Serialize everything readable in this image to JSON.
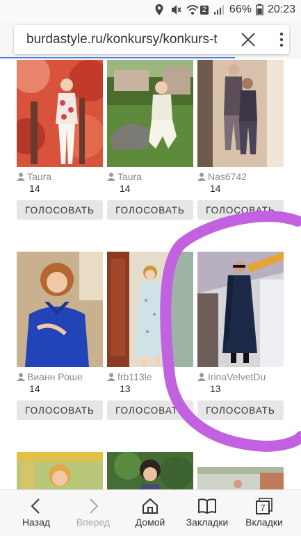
{
  "status": {
    "battery": "66%",
    "time": "20:23",
    "badge": "2"
  },
  "browser": {
    "url": "burdastyle.ru/konkursy/konkurs-t"
  },
  "entries": [
    {
      "author": "Taura",
      "votes": "14",
      "vote_label": "ГОЛОСОВАТЬ"
    },
    {
      "author": "Taura",
      "votes": "14",
      "vote_label": "ГОЛОСОВАТЬ"
    },
    {
      "author": "Nas6742",
      "votes": "14",
      "vote_label": "ГОЛОСОВАТЬ"
    },
    {
      "author": "Вианн Роше",
      "votes": "14",
      "vote_label": "ГОЛОСОВАТЬ"
    },
    {
      "author": "frb113le",
      "votes": "13",
      "vote_label": "ГОЛОСОВАТЬ"
    },
    {
      "author": "IrinaVelvetDu",
      "votes": "13",
      "vote_label": "ГОЛОСОВАТЬ"
    }
  ],
  "nav": {
    "back": "Назад",
    "forward": "Вперед",
    "home": "Домой",
    "bookmarks": "Закладки",
    "tabs": "Вкладки",
    "tabs_count": "7"
  },
  "colors": {
    "marker": "#c262e0",
    "progress": "#4c7be6"
  }
}
